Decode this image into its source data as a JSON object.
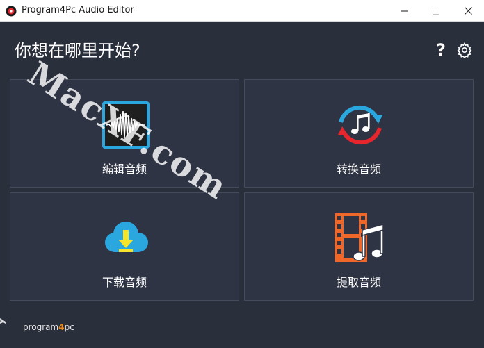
{
  "window": {
    "title": "Program4Pc Audio Editor",
    "minimize_label": "—",
    "close_label": "✕"
  },
  "header": {
    "title": "你想在哪里开始?",
    "help_label": "?"
  },
  "cards": [
    {
      "id": "edit",
      "label": "编辑音频",
      "icon": "waveform-icon"
    },
    {
      "id": "convert",
      "label": "转换音频",
      "icon": "convert-music-icon"
    },
    {
      "id": "download",
      "label": "下载音频",
      "icon": "cloud-download-icon"
    },
    {
      "id": "extract",
      "label": "提取音频",
      "icon": "film-music-icon"
    }
  ],
  "footer": {
    "brand_prefix": "program",
    "brand_digit": "4",
    "brand_suffix": "pc"
  },
  "watermark": {
    "text": "MacXF.com",
    "partial_text": "X"
  },
  "colors": {
    "background": "#2a2f3c",
    "card": "#2f3445",
    "accent_blue": "#2ba7e0",
    "accent_red": "#e5262d",
    "accent_orange": "#f0672a",
    "accent_yellow": "#f5e42a"
  }
}
